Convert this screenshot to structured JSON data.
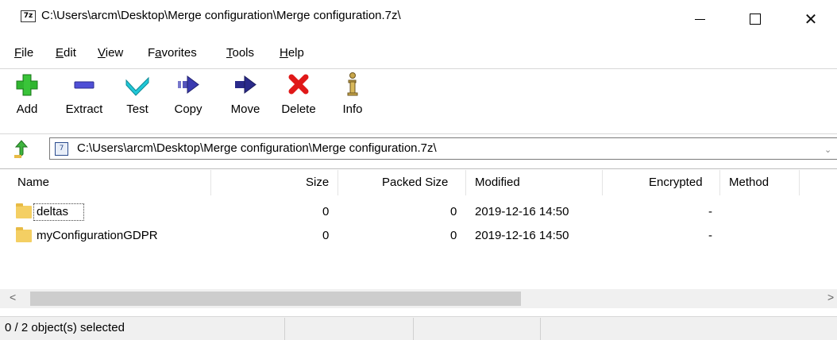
{
  "window": {
    "app_icon_text": "7z",
    "title": "C:\\Users\\arcm\\Desktop\\Merge configuration\\Merge configuration.7z\\",
    "controls": {
      "minimize": "—",
      "maximize": "☐",
      "close": "✕"
    }
  },
  "menu": [
    {
      "accel": "F",
      "rest": "ile"
    },
    {
      "accel": "E",
      "rest": "dit"
    },
    {
      "accel": "V",
      "rest": "iew"
    },
    {
      "pre": "F",
      "accel": "a",
      "rest": "vorites"
    },
    {
      "accel": "T",
      "rest": "ools"
    },
    {
      "accel": "H",
      "rest": "elp"
    }
  ],
  "toolbar": {
    "add": "Add",
    "extract": "Extract",
    "test": "Test",
    "copy": "Copy",
    "move": "Move",
    "delete": "Delete",
    "info": "Info",
    "icons": {
      "add": "plus-icon",
      "extract": "minus-icon",
      "test": "check-icon",
      "copy": "arrow-right-icon",
      "move": "arrow-right-icon",
      "delete": "cross-icon",
      "info": "info-icon"
    },
    "colors": {
      "add": "#2fb52f",
      "extract": "#4f4fd6",
      "test": "#20c8d8",
      "copy": "#3a3ab0",
      "move": "#2a2a8a",
      "delete": "#e01818",
      "info": "#c8a64a"
    }
  },
  "address": {
    "path": "C:\\Users\\arcm\\Desktop\\Merge configuration\\Merge configuration.7z\\"
  },
  "list": {
    "columns": [
      "Name",
      "Size",
      "Packed Size",
      "Modified",
      "Encrypted",
      "Method"
    ],
    "rows": [
      {
        "name": "deltas",
        "size": "0",
        "packed_size": "0",
        "modified": "2019-12-16 14:50",
        "encrypted": "-",
        "method": ""
      },
      {
        "name": "myConfigurationGDPR",
        "size": "0",
        "packed_size": "0",
        "modified": "2019-12-16 14:50",
        "encrypted": "-",
        "method": ""
      }
    ]
  },
  "status": {
    "selection": "0 / 2 object(s) selected"
  }
}
